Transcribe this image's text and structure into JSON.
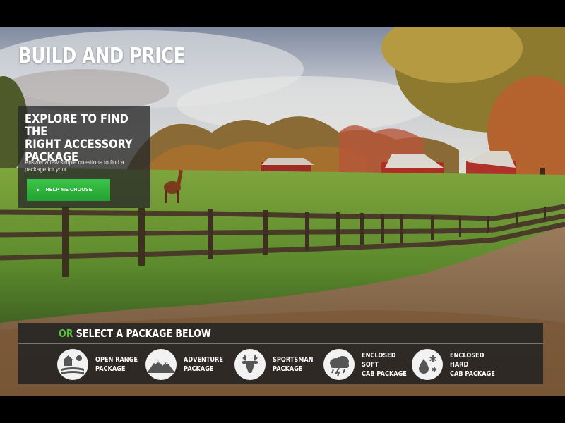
{
  "header": {
    "title": "BUILD AND PRICE"
  },
  "explore": {
    "heading": "EXPLORE TO FIND THE\nRIGHT ACCESSORY\nPACKAGE",
    "description": "Answer a few simple questions to find a package for your",
    "button_label": "HELP ME CHOOSE"
  },
  "packages": {
    "heading_or": "OR",
    "heading_rest": " SELECT A PACKAGE BELOW",
    "items": [
      {
        "label": "OPEN RANGE\nPACKAGE",
        "icon": "barn-field-icon"
      },
      {
        "label": "ADVENTURE\nPACKAGE",
        "icon": "mountains-icon"
      },
      {
        "label": "SPORTSMAN\nPACKAGE",
        "icon": "deer-icon"
      },
      {
        "label": "ENCLOSED SOFT\nCAB PACKAGE",
        "icon": "storm-cloud-icon"
      },
      {
        "label": "ENCLOSED HARD\nCAB PACKAGE",
        "icon": "rain-snow-icon"
      }
    ]
  },
  "colors": {
    "accent_green": "#23a231",
    "or_green": "#55c43a"
  }
}
